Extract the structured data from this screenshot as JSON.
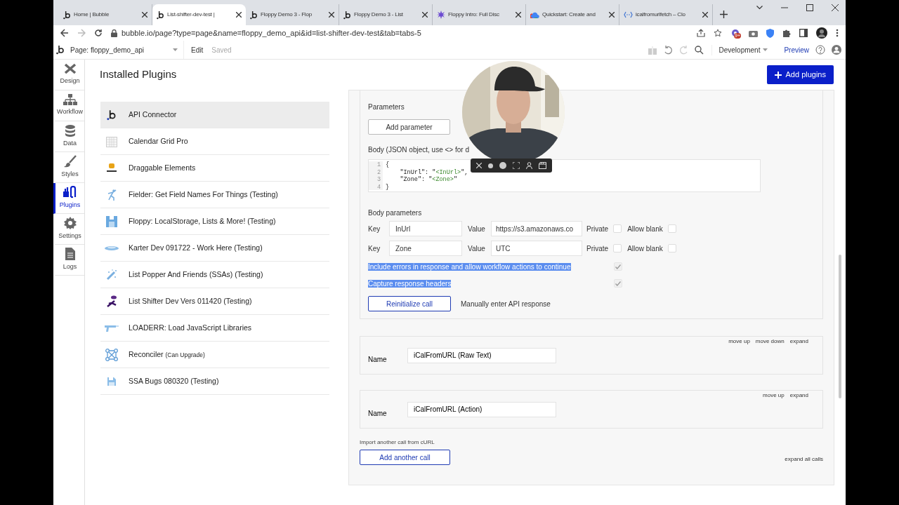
{
  "browser": {
    "tabs": [
      {
        "title": "Home | Bubble",
        "kind": "bubble",
        "selected": false
      },
      {
        "title": "List-shifter-dev-test |",
        "kind": "bubble",
        "selected": true
      },
      {
        "title": "Floppy Demo 3 - Flop",
        "kind": "bubble",
        "selected": false
      },
      {
        "title": "Floppy Demo 3 - List",
        "kind": "bubble",
        "selected": false
      },
      {
        "title": "Floppy Intro: Full Disc",
        "kind": "star",
        "selected": false
      },
      {
        "title": "Quickstart: Create and",
        "kind": "cloud",
        "selected": false
      },
      {
        "title": "icalfromurlfetch – Clo",
        "kind": "brackets",
        "selected": false
      }
    ],
    "address": "bubble.io/page?type=page&name=floppy_demo_api&id=list-shifter-dev-test&tab=tabs-5",
    "extension_badge": "9+"
  },
  "editor_bar": {
    "page": "Page: floppy_demo_api",
    "edit": "Edit",
    "saved": "Saved",
    "mode": "Development",
    "preview": "Preview"
  },
  "sidebar": {
    "items": [
      {
        "label": "Design",
        "kind": "design",
        "selected": false
      },
      {
        "label": "Workflow",
        "kind": "workflow",
        "selected": false
      },
      {
        "label": "Data",
        "kind": "data",
        "selected": false
      },
      {
        "label": "Styles",
        "kind": "styles",
        "selected": false
      },
      {
        "label": "Plugins",
        "kind": "plugins",
        "selected": true
      },
      {
        "label": "Settings",
        "kind": "settings",
        "selected": false
      },
      {
        "label": "Logs",
        "kind": "logs",
        "selected": false
      }
    ]
  },
  "heading": "Installed Plugins",
  "add_plugins": "Add plugins",
  "plugins": [
    {
      "name": "API Connector",
      "kind": "bubble",
      "selected": true
    },
    {
      "name": "Calendar Grid Pro",
      "kind": "calendar",
      "selected": false
    },
    {
      "name": "Draggable Elements",
      "kind": "drag",
      "selected": false
    },
    {
      "name": "Fielder: Get Field Names For Things (Testing)",
      "kind": "figure",
      "selected": false
    },
    {
      "name": "Floppy: LocalStorage, Lists & More! (Testing)",
      "kind": "floppy",
      "selected": false
    },
    {
      "name": "Karter Dev 091722 - Work Here (Testing)",
      "kind": "disc",
      "selected": false
    },
    {
      "name": "List Popper And Friends (SSAs) (Testing)",
      "kind": "wand",
      "selected": false
    },
    {
      "name": "List Shifter Dev Vers 011420 (Testing)",
      "kind": "shifter",
      "selected": false
    },
    {
      "name": "LOADERR: Load JavaScript Libraries",
      "kind": "gun",
      "selected": false
    },
    {
      "name": "Reconciler",
      "note": "(Can Upgrade)",
      "kind": "nodes",
      "selected": false
    },
    {
      "name": "SSA Bugs 080320 (Testing)",
      "kind": "save",
      "selected": false
    }
  ],
  "call": {
    "parameters_label": "Parameters",
    "add_parameter": "Add parameter",
    "body_label": "Body (JSON object, use <> for d",
    "code_lines": [
      {
        "number": "1",
        "parts": [
          {
            "text": "{",
            "kind": "plain"
          }
        ]
      },
      {
        "number": "2",
        "parts": [
          {
            "text": "    \"InUrl\": \"",
            "kind": "plain"
          },
          {
            "text": "<InUrl>",
            "kind": "dynamic"
          },
          {
            "text": "\",",
            "kind": "plain"
          }
        ]
      },
      {
        "number": "3",
        "parts": [
          {
            "text": "    \"Zone\": \"",
            "kind": "plain"
          },
          {
            "text": "<Zone>",
            "kind": "dynamic"
          },
          {
            "text": "\"",
            "kind": "plain"
          }
        ]
      },
      {
        "number": "4",
        "parts": [
          {
            "text": "}",
            "kind": "plain"
          }
        ]
      }
    ],
    "body_parameters_label": "Body parameters",
    "body_params": [
      {
        "key_label": "Key",
        "key": "InUrl",
        "value_label": "Value",
        "value": "https://s3.amazonaws.co",
        "private_label": "Private",
        "private": false,
        "allow_blank_label": "Allow blank",
        "allow_blank": false
      },
      {
        "key_label": "Key",
        "key": "Zone",
        "value_label": "Value",
        "value": "UTC",
        "private_label": "Private",
        "private": false,
        "allow_blank_label": "Allow blank",
        "allow_blank": false
      }
    ],
    "options": [
      {
        "label": "Include errors in response and allow workflow actions to continue",
        "checked": true,
        "highlighted": true
      },
      {
        "label": "Capture response headers",
        "checked": true,
        "highlighted": true
      }
    ],
    "reinitialize": "Reinitialize call",
    "manual": "Manually enter API response"
  },
  "other_calls": [
    {
      "name_label": "Name",
      "name": "iCalFromURL (Raw Text)",
      "actions": [
        "move up",
        "move down",
        "expand"
      ]
    },
    {
      "name_label": "Name",
      "name": "iCalFromURL (Action)",
      "actions": [
        "move up",
        "expand"
      ]
    }
  ],
  "import_label": "Import another call from cURL",
  "add_call": "Add another call",
  "expand_all": "expand all calls"
}
